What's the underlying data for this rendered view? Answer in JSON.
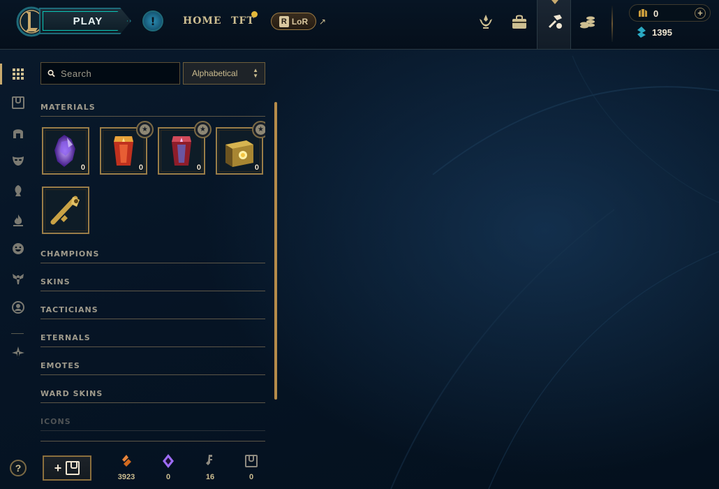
{
  "topbar": {
    "play_label": "PLAY",
    "alert_label": "!",
    "nav": [
      {
        "label": "HOME"
      },
      {
        "label": "TFT"
      }
    ],
    "lor_label": "LoR",
    "lor_letter": "R",
    "external_arrow": "↗",
    "icons": [
      "missions-icon",
      "inventory-bag-icon",
      "crafting-hammer-icon",
      "store-coins-icon"
    ],
    "rp_value": "0",
    "plus_label": "+",
    "be_value": "1395"
  },
  "rail": {
    "icons": [
      "grid-icon",
      "chest-icon",
      "champion-helmet-icon",
      "skins-mask-icon",
      "tactician-icon",
      "eternals-flame-icon",
      "emote-icon",
      "ward-icon",
      "profile-icon-icon",
      "misc-icon"
    ],
    "help_label": "?"
  },
  "search": {
    "placeholder": "Search"
  },
  "sort": {
    "selected": "Alphabetical"
  },
  "loot": {
    "sections": [
      {
        "label": "MATERIALS"
      },
      {
        "label": "CHAMPIONS"
      },
      {
        "label": "SKINS"
      },
      {
        "label": "TACTICIANS"
      },
      {
        "label": "ETERNALS"
      },
      {
        "label": "EMOTES"
      },
      {
        "label": "WARD SKINS"
      },
      {
        "label": "ICONS"
      }
    ],
    "materials": [
      {
        "name": "purple-crystal",
        "count": "0",
        "starred": false
      },
      {
        "name": "red-capsule",
        "count": "0",
        "starred": true
      },
      {
        "name": "crimson-capsule",
        "count": "0",
        "starred": true
      },
      {
        "name": "golden-chest",
        "count": "0",
        "starred": true
      },
      {
        "name": "hextech-key",
        "count": "",
        "starred": false
      }
    ],
    "star_glyph": "★"
  },
  "bottom": {
    "add_label": "+",
    "resources": [
      {
        "icon": "orange-essence-icon",
        "value": "3923"
      },
      {
        "icon": "mythic-essence-icon",
        "value": "0"
      },
      {
        "icon": "key-fragment-icon",
        "value": "16"
      },
      {
        "icon": "chest-count-icon",
        "value": "0"
      }
    ]
  },
  "colors": {
    "gold": "#c8aa6e",
    "text_gold": "#cdbe91",
    "header_gray": "#a09b8c",
    "teal": "#0ac8b9",
    "background": "#061526"
  }
}
